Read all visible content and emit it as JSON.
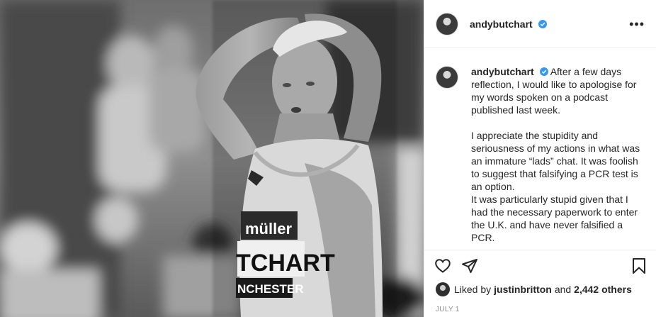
{
  "post": {
    "username": "andybutchart",
    "verified": true,
    "more_label": "•••",
    "caption_username": "andybutchart",
    "caption_text": " After a few days reflection, I would like to apologise for my words spoken on a podcast published last week.\n\nI appreciate the stupidity and seriousness of my actions in what was an immature “lads” chat. It was foolish to suggest that falsifying a PCR test is an option.\nIt was particularly stupid given that I had the necessary paperwork to enter the U.K. and have never falsified a PCR.\n\nI will use this episode to the phone to",
    "bib_sponsor": "müller",
    "bib_name": "TCHART",
    "bib_city": "NCHESTER",
    "likes_prefix": "Liked by",
    "likes_user": "justinbritton",
    "likes_and": "and",
    "likes_count": "2,442 others",
    "date": "JULY 1"
  },
  "icons": {
    "like": "heart-outline-icon",
    "share": "paper-plane-icon",
    "save": "bookmark-icon",
    "verified": "verified-badge-icon",
    "more": "more-options-icon"
  },
  "colors": {
    "verified_blue": "#3897f0",
    "text": "#262626",
    "muted": "#8e8e8e",
    "divider": "#efefef"
  }
}
